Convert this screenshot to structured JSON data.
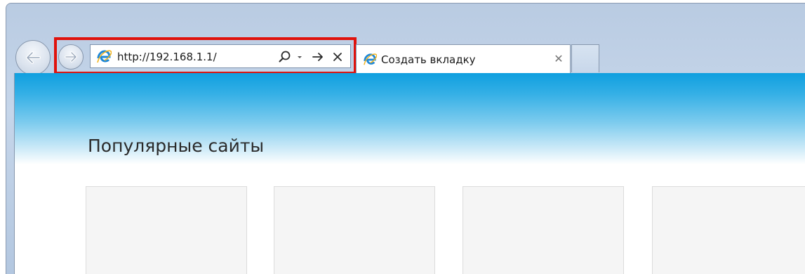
{
  "address_bar": {
    "url": "http://192.168.1.1/"
  },
  "tab": {
    "title": "Создать вкладку",
    "close_glyph": "✕"
  },
  "new_tab_page": {
    "heading": "Популярные сайты",
    "tile_count": 4
  },
  "colors": {
    "highlight": "#e0120c",
    "header_gradient_top": "#0f9fdf",
    "ie_logo_blue": "#1e88d8",
    "ie_logo_ring": "#f2b31a"
  }
}
